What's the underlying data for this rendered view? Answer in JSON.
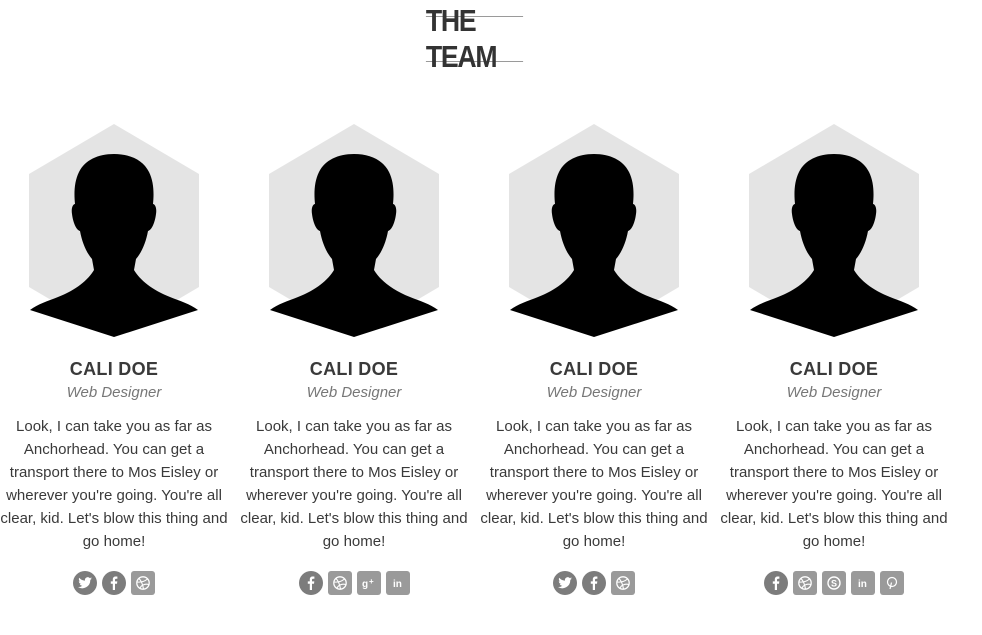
{
  "section": {
    "title": "THE TEAM"
  },
  "members": [
    {
      "name": "CALI DOE",
      "role": "Web Designer",
      "bio": "Look, I can take you as far as Anchorhead. You can get a transport there to Mos Eisley or wherever you're going. You're all clear, kid. Let's blow this thing and go home!",
      "social": [
        "twitter-icon",
        "facebook-icon",
        "dribbble-icon"
      ]
    },
    {
      "name": "CALI DOE",
      "role": "Web Designer",
      "bio": "Look, I can take you as far as Anchorhead. You can get a transport there to Mos Eisley or wherever you're going. You're all clear, kid. Let's blow this thing and go home!",
      "social": [
        "facebook-icon",
        "dribbble-icon",
        "google-plus-icon",
        "linkedin-icon"
      ]
    },
    {
      "name": "CALI DOE",
      "role": "Web Designer",
      "bio": "Look, I can take you as far as Anchorhead. You can get a transport there to Mos Eisley or wherever you're going. You're all clear, kid. Let's blow this thing and go home!",
      "social": [
        "twitter-icon",
        "facebook-icon",
        "dribbble-icon"
      ]
    },
    {
      "name": "CALI DOE",
      "role": "Web Designer",
      "bio": "Look, I can take you as far as Anchorhead. You can get a transport there to Mos Eisley or wherever you're going. You're all clear, kid. Let's blow this thing and go home!",
      "social": [
        "facebook-icon",
        "dribbble-icon",
        "skype-icon",
        "linkedin-icon",
        "pinterest-icon"
      ]
    }
  ],
  "colors": {
    "hexagon_bg": "#e4e4e4",
    "silhouette": "#000000",
    "icon_bg": "#7c7c7c",
    "text": "#3a3a3a",
    "role_text": "#777777"
  }
}
